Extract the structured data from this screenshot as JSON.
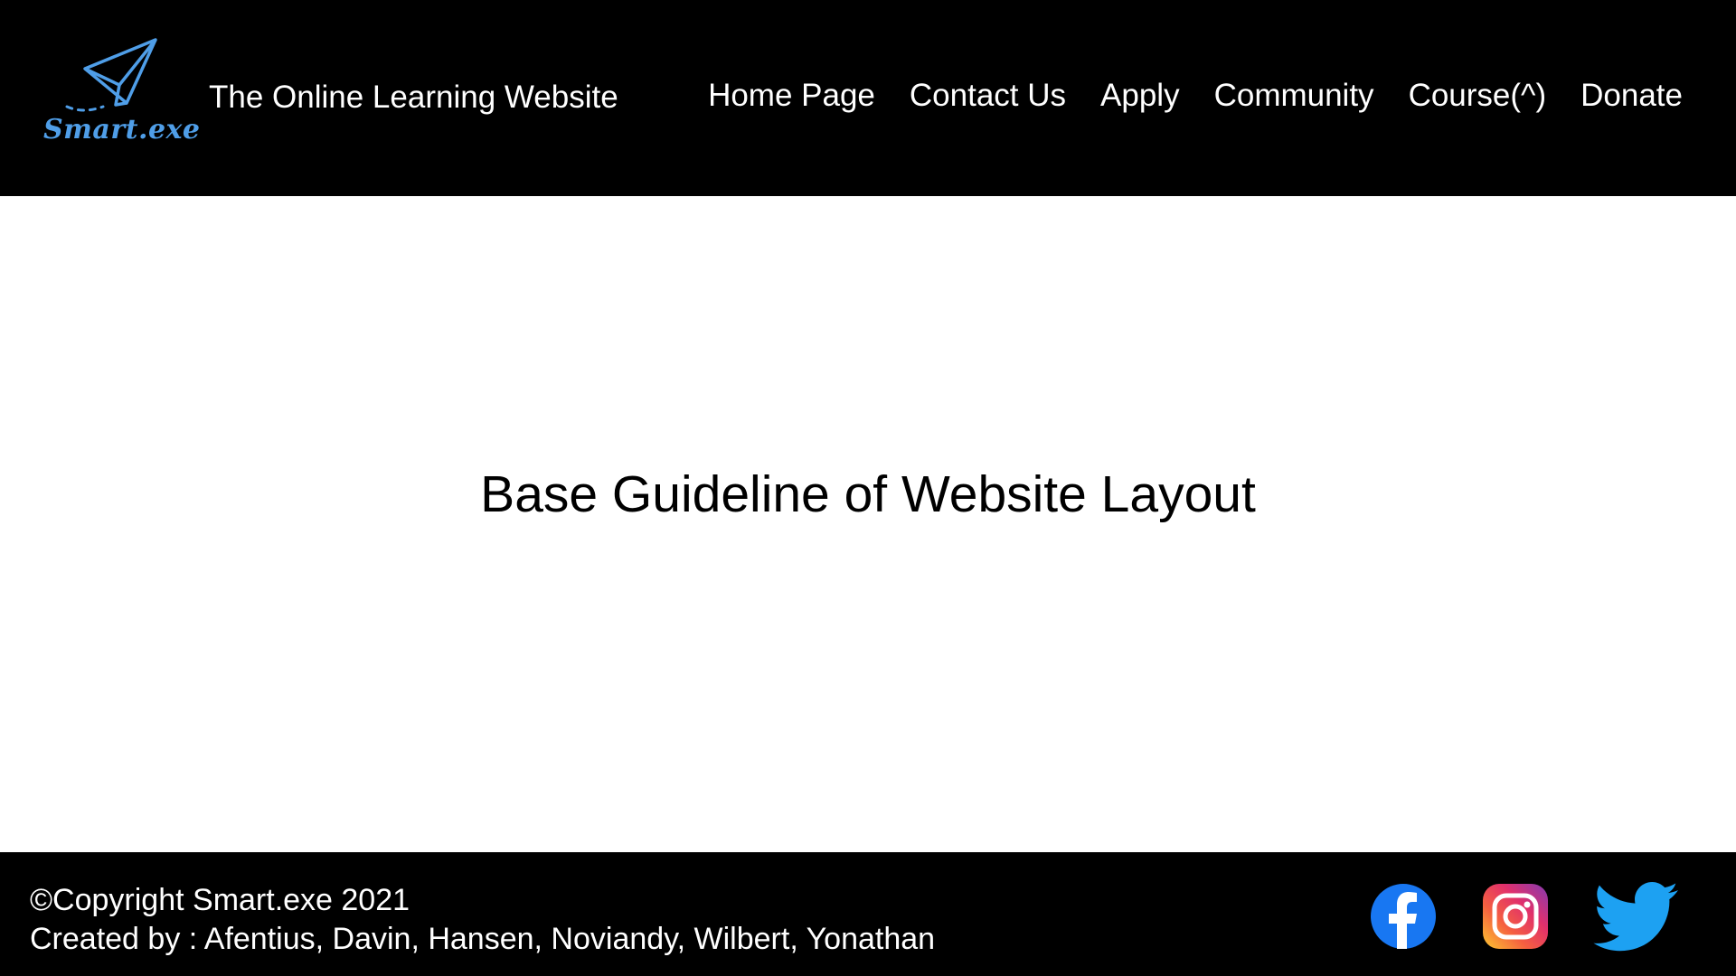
{
  "header": {
    "logo_text": "Smart.exe",
    "site_title": "The Online Learning Website",
    "nav": [
      "Home Page",
      "Contact Us",
      "Apply",
      "Community",
      "Course(^)",
      "Donate"
    ]
  },
  "main": {
    "title": "Base Guideline of Website Layout"
  },
  "footer": {
    "copyright": "©Copyright Smart.exe 2021",
    "credits": "Created by : Afentius, Davin, Hansen, Noviandy, Wilbert, Yonathan",
    "social": [
      "facebook-icon",
      "instagram-icon",
      "twitter-icon"
    ]
  },
  "colors": {
    "header_bg": "#000000",
    "footer_bg": "#000000",
    "logo_blue": "#4f9ee8",
    "facebook_blue": "#1877f2",
    "twitter_blue": "#1da1f2"
  }
}
